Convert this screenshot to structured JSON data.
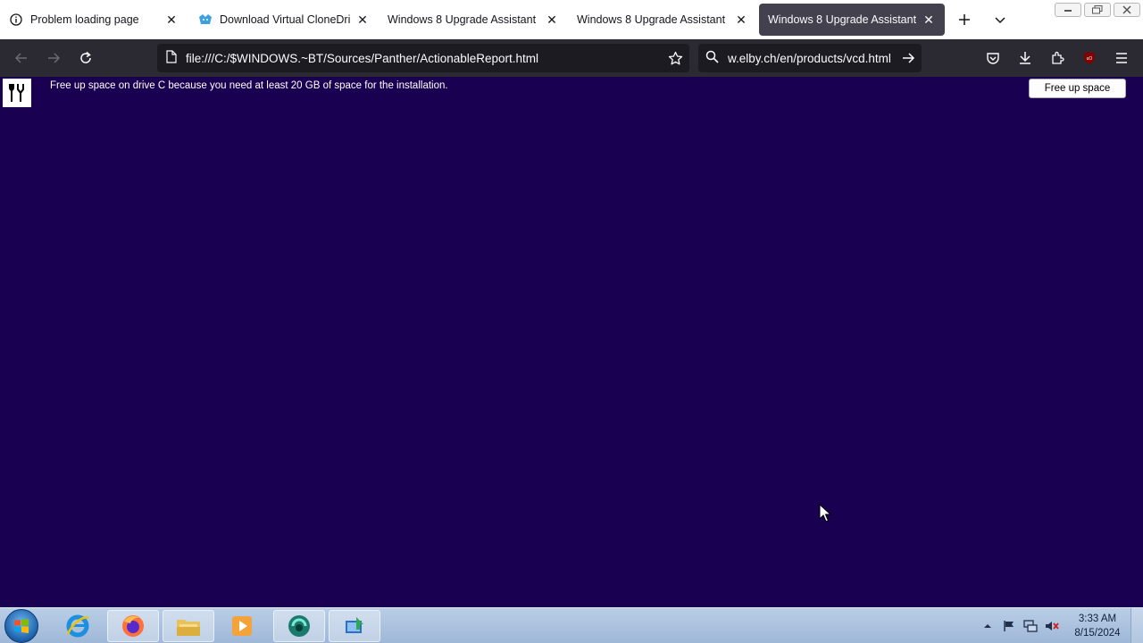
{
  "tabs": [
    {
      "title": "Problem loading page",
      "icon": "info-icon"
    },
    {
      "title": "Download Virtual CloneDrive",
      "icon": "clonedrive-sheep-icon"
    },
    {
      "title": "Windows 8 Upgrade Assistant",
      "icon": ""
    },
    {
      "title": "Windows 8 Upgrade Assistant",
      "icon": ""
    },
    {
      "title": "Windows 8 Upgrade Assistant",
      "icon": "",
      "active": true
    }
  ],
  "navbar": {
    "url": "file:///C:/$WINDOWS.~BT/Sources/Panther/ActionableReport.html",
    "search_value": "w.elby.ch/en/products/vcd.html"
  },
  "page": {
    "message": "Free up space on drive C because you need at least 20 GB of space for the installation.",
    "free_up_button": "Free up space",
    "background_color": "#1a0050"
  },
  "taskbar": {
    "pinned": [
      "internet-explorer-icon",
      "firefox-icon",
      "file-explorer-icon",
      "media-player-icon",
      "app-icon",
      "upgrade-assistant-icon"
    ],
    "clock_time": "3:33 AM",
    "clock_date": "8/15/2024"
  }
}
